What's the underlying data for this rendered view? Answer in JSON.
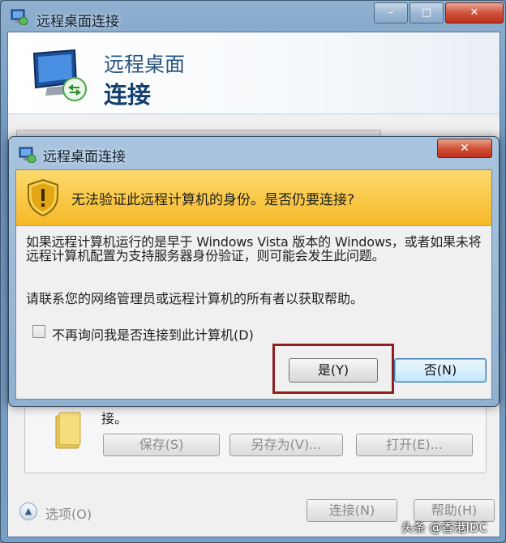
{
  "outer": {
    "title": "远程桌面连接",
    "header_line1": "远程桌面",
    "header_line2": "连接",
    "connect_tail": "接。",
    "save_label": "保存(S)",
    "save_as_label": "另存为(V)...",
    "open_label": "打开(E)...",
    "options_label": "选项(O)",
    "connect_label": "连接(N)",
    "help_label": "帮助(H)",
    "caption_min": "–",
    "caption_max": "□",
    "caption_close": "✕"
  },
  "dialog": {
    "title": "远程桌面连接",
    "close_glyph": "✕",
    "warning": "无法验证此远程计算机的身份。是否仍要连接?",
    "body1": "如果远程计算机运行的是早于 Windows Vista 版本的 Windows，或者如果未将远程计算机配置为支持服务器身份验证，则可能会发生此问题。",
    "body2": "请联系您的网络管理员或远程计算机的所有者以获取帮助。",
    "checkbox_label": "不再询问我是否连接到此计算机(D)",
    "checkbox_checked": false,
    "yes_label": "是(Y)",
    "no_label": "否(N)"
  },
  "watermark": "头条 @香港IDC",
  "colors": {
    "warning_band": "#f6b927",
    "highlight": "#8f1f21",
    "close_button": "#d25337"
  },
  "icons": {
    "app": "remote-desktop-icon",
    "warning": "shield-warning-icon",
    "folder": "folder-icon"
  }
}
